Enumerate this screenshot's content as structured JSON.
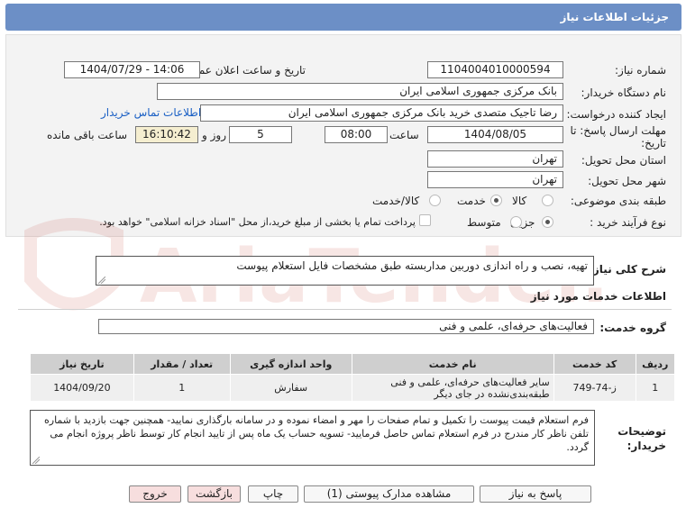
{
  "header": {
    "title": "جزئیات اطلاعات نیاز"
  },
  "fields": {
    "need_number_label": "شماره نیاز:",
    "need_number": "1104004010000594",
    "announce_label": "تاریخ و ساعت اعلان عمومی:",
    "announce_value": "1404/07/29 - 14:06",
    "buyer_label": "نام دستگاه خریدار:",
    "buyer_value": "بانک مرکزی جمهوری اسلامی ایران",
    "creator_label": "ایجاد کننده درخواست:",
    "creator_value": "رضا تاجیک متصدی خرید بانک مرکزی جمهوری اسلامی ایران",
    "contact_link": "اطلاعات تماس خریدار",
    "deadline_label_1": "مهلت ارسال پاسخ: تا",
    "deadline_label_2": "تاریخ:",
    "deadline_date": "1404/08/05",
    "time_label": "ساعت",
    "deadline_time": "08:00",
    "days_value": "5",
    "days_label": "روز و",
    "remaining_time": "16:10:42",
    "remaining_label": "ساعت باقی مانده",
    "province_label": "استان محل تحویل:",
    "province_value": "تهران",
    "city_label": "شهر محل تحویل:",
    "city_value": "تهران",
    "category_label": "طبقه بندی موضوعی:",
    "category_options": [
      "کالا",
      "خدمت",
      "کالا/خدمت"
    ],
    "category_selected": "خدمت",
    "process_label": "نوع فرآیند خرید :",
    "process_options": [
      "جزیی",
      "متوسط"
    ],
    "process_selected": "جزیی",
    "treasury_note": "پرداخت تمام یا بخشی از مبلغ خرید،از محل \"اسناد خزانه اسلامی\" خواهد بود."
  },
  "description": {
    "label": "شرح کلی نیاز:",
    "value": "تهیه، نصب و راه اندازی دوربین مداربسته طبق مشخصات فایل استعلام پیوست"
  },
  "services": {
    "section_title": "اطلاعات خدمات مورد نیاز",
    "group_label": "گروه خدمت:",
    "group_value": "فعالیت‌های حرفه‌ای، علمی و فنی",
    "columns": [
      "ردیف",
      "کد خدمت",
      "نام خدمت",
      "واحد اندازه گیری",
      "تعداد / مقدار",
      "تاریخ نیاز"
    ],
    "rows": [
      {
        "row": "1",
        "code": "ز-74-749",
        "name": "سایر فعالیت‌های حرفه‌ای، علمی و فنی طبقه‌بندی‌نشده در جای دیگر",
        "unit": "سفارش",
        "qty": "1",
        "date": "1404/09/20"
      }
    ]
  },
  "buyer_notes": {
    "label_1": "توضیحات",
    "label_2": "خریدار:",
    "value": "فرم استعلام قیمت پیوست را تکمیل و تمام صفحات را مهر و امضاء نموده و در سامانه بارگذاری نمایید- همچنین جهت بازدید با شماره تلفن ناظر کار مندرج در فرم استعلام تماس حاصل فرمایید- تسویه حساب یک ماه پس از تایید انجام کار توسط ناظر پروژه انجام می گردد."
  },
  "buttons": {
    "reply": "پاسخ به نیاز",
    "attachments": "مشاهده مدارک پیوستی (1)",
    "print": "چاپ",
    "back": "بازگشت",
    "exit": "خروج"
  },
  "watermark": {
    "text": "AriaTender.net"
  },
  "colors": {
    "header_bg": "#6c8fc6",
    "link": "#1a5fc4",
    "remaining_bg": "#f5eed0",
    "exit_bg": "#f7dede",
    "watermark": "#c0392b"
  }
}
